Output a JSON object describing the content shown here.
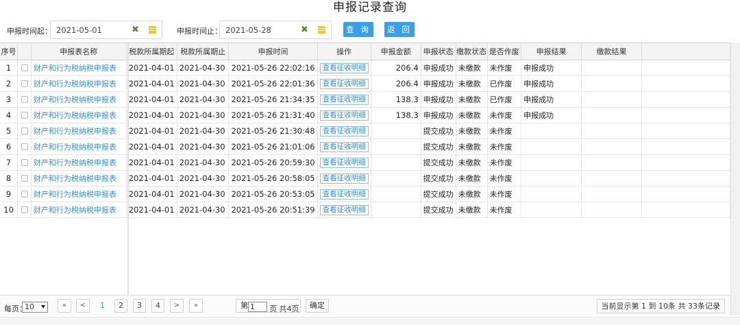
{
  "title": "申报记录查询",
  "filter": {
    "start_label": "申报时间起：",
    "start_value": "2021-05-01",
    "end_label": "申报时间止：",
    "end_value": "2021-05-28",
    "query_button": "查 询",
    "back_button": "返 回"
  },
  "columns": [
    "序号",
    "申报表名称",
    "税款所属期起",
    "税款所属期止",
    "申报时间",
    "操作",
    "申报金额",
    "申报状态",
    "缴款状态",
    "是否作废",
    "申报结果",
    "缴款结果"
  ],
  "rows": [
    {
      "no": "1",
      "name": "财产和行为税纳税申报表",
      "start": "2021-04-01",
      "end": "2021-04-30",
      "time": "2021-05-26 22:02:16",
      "action": "查看征收明细",
      "amount": "206.4",
      "status": "申报成功",
      "pay": "未缴款",
      "void": "未作废",
      "result": "申报成功",
      "pay_result": ""
    },
    {
      "no": "2",
      "name": "财产和行为税纳税申报表",
      "start": "2021-04-01",
      "end": "2021-04-30",
      "time": "2021-05-26 22:01:36",
      "action": "查看征收明细",
      "amount": "206.4",
      "status": "申报成功",
      "pay": "未缴款",
      "void": "已作废",
      "result": "申报成功",
      "pay_result": ""
    },
    {
      "no": "3",
      "name": "财产和行为税纳税申报表",
      "start": "2021-04-01",
      "end": "2021-04-30",
      "time": "2021-05-26 21:34:35",
      "action": "查看征收明细",
      "amount": "138.3",
      "status": "申报成功",
      "pay": "未缴款",
      "void": "已作废",
      "result": "申报成功",
      "pay_result": ""
    },
    {
      "no": "4",
      "name": "财产和行为税纳税申报表",
      "start": "2021-04-01",
      "end": "2021-04-30",
      "time": "2021-05-26 21:31:40",
      "action": "查看征收明细",
      "amount": "138.3",
      "status": "申报成功",
      "pay": "未缴款",
      "void": "未作废",
      "result": "申报成功",
      "pay_result": ""
    },
    {
      "no": "5",
      "name": "财产和行为税纳税申报表",
      "start": "2021-04-01",
      "end": "2021-04-30",
      "time": "2021-05-26 21:30:48",
      "action": "查看征收明细",
      "amount": "",
      "status": "提交成功",
      "pay": "未缴款",
      "void": "未作废",
      "result": "",
      "pay_result": ""
    },
    {
      "no": "6",
      "name": "财产和行为税纳税申报表",
      "start": "2021-04-01",
      "end": "2021-04-30",
      "time": "2021-05-26 21:01:06",
      "action": "查看征收明细",
      "amount": "",
      "status": "提交成功",
      "pay": "未缴款",
      "void": "未作废",
      "result": "",
      "pay_result": ""
    },
    {
      "no": "7",
      "name": "财产和行为税纳税申报表",
      "start": "2021-04-01",
      "end": "2021-04-30",
      "time": "2021-05-26 20:59:30",
      "action": "查看征收明细",
      "amount": "",
      "status": "提交成功",
      "pay": "未缴款",
      "void": "未作废",
      "result": "",
      "pay_result": ""
    },
    {
      "no": "8",
      "name": "财产和行为税纳税申报表",
      "start": "2021-04-01",
      "end": "2021-04-30",
      "time": "2021-05-26 20:58:05",
      "action": "查看征收明细",
      "amount": "",
      "status": "提交成功",
      "pay": "未缴款",
      "void": "未作废",
      "result": "",
      "pay_result": ""
    },
    {
      "no": "9",
      "name": "财产和行为税纳税申报表",
      "start": "2021-04-01",
      "end": "2021-04-30",
      "time": "2021-05-26 20:53:05",
      "action": "查看征收明细",
      "amount": "",
      "status": "提交成功",
      "pay": "未缴款",
      "void": "未作废",
      "result": "",
      "pay_result": ""
    },
    {
      "no": "10",
      "name": "财产和行为税纳税申报表",
      "start": "2021-04-01",
      "end": "2021-04-30",
      "time": "2021-05-26 20:51:39",
      "action": "查看征收明细",
      "amount": "",
      "status": "提交成功",
      "pay": "未缴款",
      "void": "未作废",
      "result": "",
      "pay_result": ""
    }
  ],
  "pager": {
    "per_page_label": "每页：",
    "per_page_value": "10",
    "first": "«",
    "prev": "<",
    "pages": [
      "1",
      "2",
      "3",
      "4"
    ],
    "next": ">",
    "last": "»",
    "goto_prefix": "第",
    "goto_value": "1",
    "goto_suffix": "页 共4页",
    "confirm": "确定",
    "info": "当前显示第  1 到  10条 共  33条记录"
  }
}
